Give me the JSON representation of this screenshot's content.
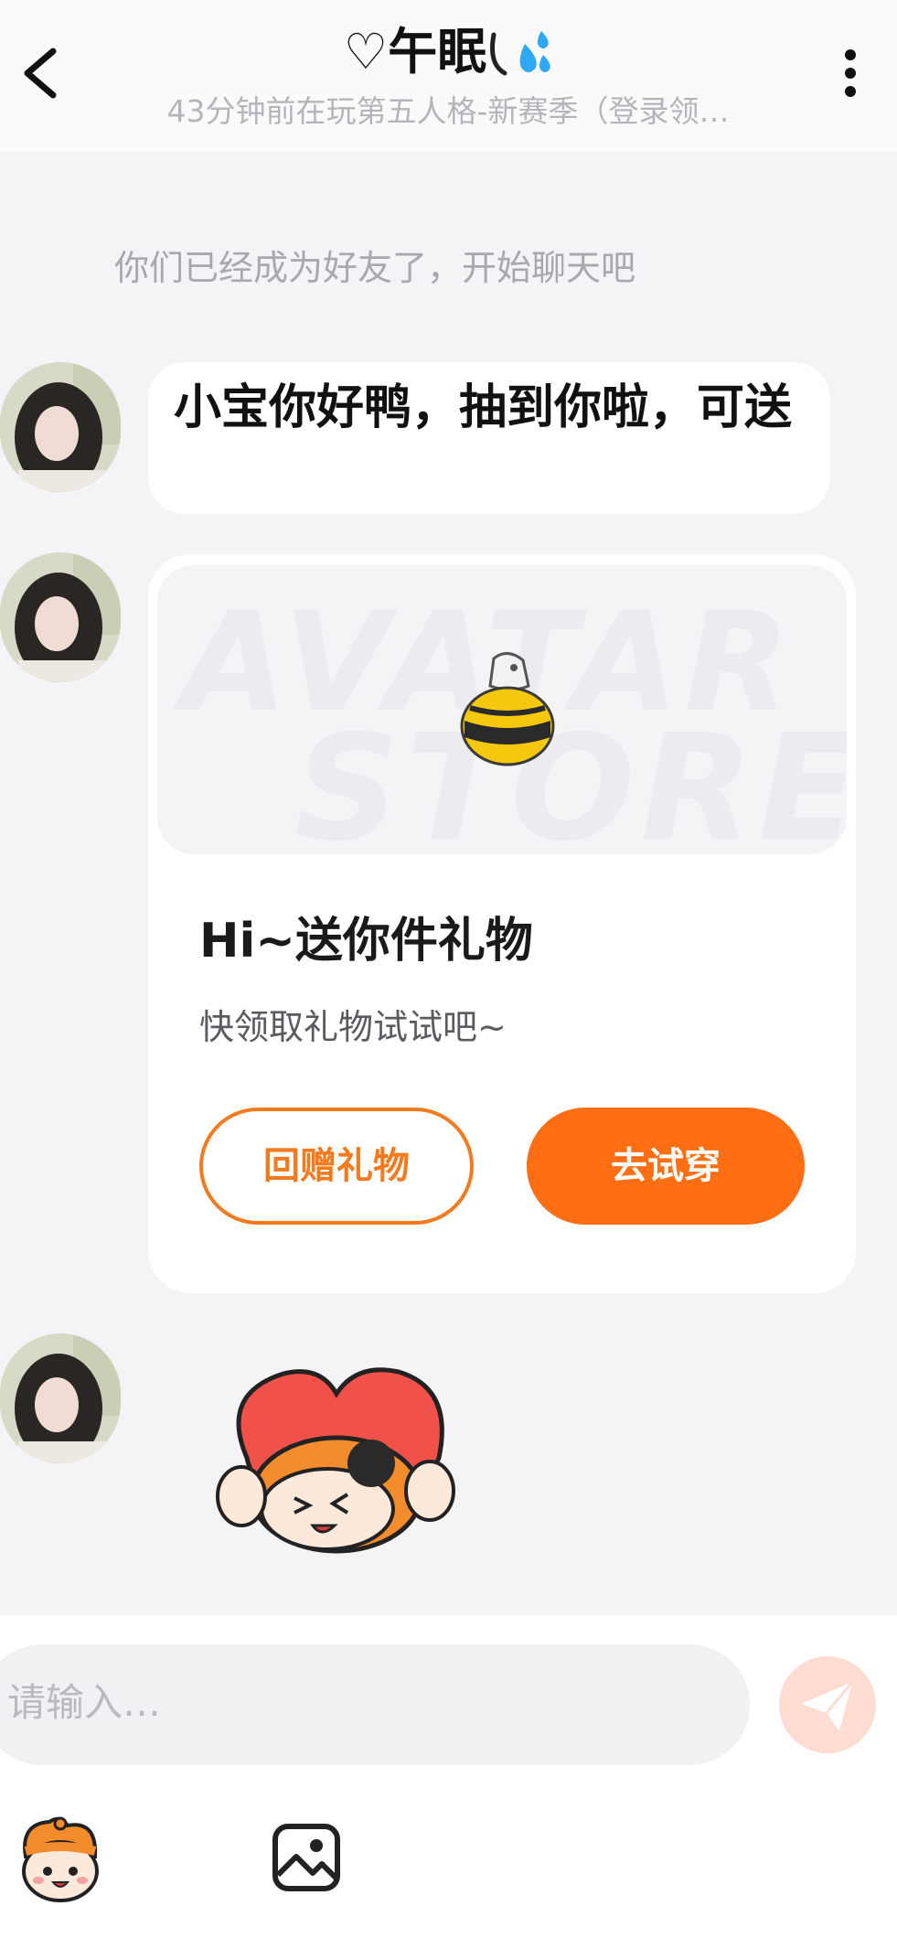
{
  "header": {
    "title": "♡午眠",
    "subtitle": "43分钟前在玩第五人格-新赛季（登录领…",
    "back_icon": "chevron-left-icon",
    "more_icon": "more-vertical-icon"
  },
  "system_message": "你们已经成为好友了，开始聊天吧",
  "messages": [
    {
      "type": "text",
      "text": "小宝你好鸭，抽到你啦，可送"
    },
    {
      "type": "gift_card",
      "banner_watermark_1": "AVATAR",
      "banner_watermark_2": "STORE",
      "title": "Hi~送你件礼物",
      "subtitle": "快领取礼物试试吧~",
      "secondary_button": "回赠礼物",
      "primary_button": "去试穿"
    },
    {
      "type": "sticker",
      "icon": "mascot-sticker"
    }
  ],
  "input": {
    "placeholder": "请输入…"
  },
  "colors": {
    "accent": "#ff6e13",
    "background": "#f4f4f7",
    "send_button": "#ffd9cf"
  }
}
